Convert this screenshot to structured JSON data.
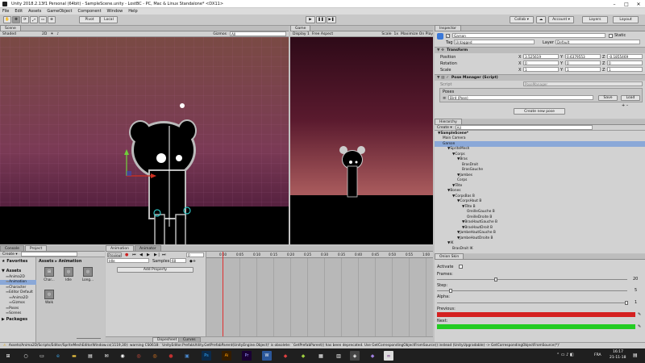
{
  "window": {
    "title": "Unity 2018.2.13f1 Personal (64bit) - SampleScene.unity - LostBC - PC, Mac & Linux Standalone* <DX11>"
  },
  "menu": [
    "File",
    "Edit",
    "Assets",
    "GameObject",
    "Component",
    "Window",
    "Help"
  ],
  "toolbar": {
    "pivot": "Pivot",
    "space": "Local",
    "collab": "Collab ▾",
    "account": "Account ▾",
    "layers": "Layers",
    "layout": "Layout"
  },
  "scene": {
    "tab": "Scene",
    "shading": "Shaded",
    "mode2d": "2D",
    "gizmos": "Gizmos",
    "search": "All"
  },
  "game": {
    "tab": "Game",
    "display": "Display 1",
    "aspect": "Free Aspect",
    "scale_label": "Scale",
    "scale_value": "1x",
    "maximize": "Maximize On Play"
  },
  "inspector": {
    "tab": "Inspector",
    "object_name": "Garson",
    "static": "Static",
    "tag_label": "Tag",
    "tag_value": "Untagged",
    "layer_label": "Layer",
    "layer_value": "Default",
    "transform": {
      "title": "Transform",
      "position": "Position",
      "rotation": "Rotation",
      "scale": "Scale",
      "pos": {
        "x": "3.525619",
        "y": "0.6379553",
        "z": "-0.1855469"
      },
      "rot": {
        "x": "0",
        "y": "0",
        "z": "0"
      },
      "scl": {
        "x": "1",
        "y": "1",
        "z": "1"
      }
    },
    "pose_manager": {
      "title": "Pose Manager (Script)",
      "script_label": "Script",
      "script_value": "PoseManager",
      "poses": "Poses",
      "pose_item": "Bird (Pose)",
      "save": "Save",
      "load": "Load",
      "create": "Create new pose"
    }
  },
  "hierarchy": {
    "tab": "Hierarchy",
    "create": "Create ▾",
    "search": "All",
    "items": [
      {
        "label": "SampleScene*",
        "indent": 0
      },
      {
        "label": "Main Camera",
        "indent": 1
      },
      {
        "label": "Garson",
        "indent": 1
      },
      {
        "label": "SpriteMesh",
        "indent": 2
      },
      {
        "label": "Corps",
        "indent": 3
      },
      {
        "label": "Bras",
        "indent": 4
      },
      {
        "label": "BrasDroit",
        "indent": 5
      },
      {
        "label": "BrasGauche",
        "indent": 5
      },
      {
        "label": "Jambes",
        "indent": 4
      },
      {
        "label": "Corps",
        "indent": 4
      },
      {
        "label": "Tête",
        "indent": 3
      },
      {
        "label": "Bones",
        "indent": 2
      },
      {
        "label": "CorpsBas B",
        "indent": 3
      },
      {
        "label": "CorpsHaut B",
        "indent": 4
      },
      {
        "label": "Tête B",
        "indent": 5
      },
      {
        "label": "OreilleGauche B",
        "indent": 6
      },
      {
        "label": "OreilleDroite B",
        "indent": 6
      },
      {
        "label": "BrasHautGauche B",
        "indent": 5
      },
      {
        "label": "BrasHautDroit B",
        "indent": 5
      },
      {
        "label": "JambeHautGauche B",
        "indent": 4
      },
      {
        "label": "JambeHautDroite B",
        "indent": 4
      },
      {
        "label": "IK",
        "indent": 2
      },
      {
        "label": "BrasDroit IK",
        "indent": 3
      }
    ]
  },
  "onion": {
    "tab": "Onion Skin",
    "activate": "Activate",
    "frames": "Frames:",
    "frames_value": "20",
    "step": "Step:",
    "step_value": "5",
    "alpha": "Alpha:",
    "alpha_value": "1",
    "previous": "Previous:",
    "next": "Next:",
    "prev_color": "#d42020",
    "next_color": "#22cc22"
  },
  "project": {
    "tabs": [
      "Console",
      "Project"
    ],
    "create": "Create ▾",
    "favorites": "Favorites",
    "assets": "Assets",
    "tree": [
      "Anima2D",
      "Animation",
      "Character",
      "Editor Default",
      "Anima2D",
      "Gizmos",
      "Poses",
      "Scenes"
    ],
    "packages": "Packages",
    "breadcrumb": "Assets ▸ Animation",
    "files": [
      {
        "name": "Char...",
        "icon": "anim-controller-icon"
      },
      {
        "name": "Idle",
        "icon": "anim-clip-icon"
      },
      {
        "name": "Long...",
        "icon": "anim-clip-icon"
      },
      {
        "name": "Walk",
        "icon": "anim-clip-icon"
      }
    ]
  },
  "animation": {
    "tabs": [
      "Animation",
      "Animator"
    ],
    "preview": "Preview",
    "clip": "Idle",
    "samples": "Samples",
    "samples_value": "60",
    "frame": "0",
    "add_property": "Add Property",
    "dopesheet": "Dopesheet",
    "curves": "Curves",
    "ticks": [
      "0:00",
      "0:05",
      "0:10",
      "0:15",
      "0:20",
      "0:25",
      "0:30",
      "0:35",
      "0:40",
      "0:45",
      "0:50",
      "0:55",
      "1:00"
    ]
  },
  "status": "Assets/Anima2D/Scripts/Editor/SpriteMeshEditorWindow.cs(1119,30): warning CS0618: `UnityEditor.PrefabUtility.GetPrefabParent(UnityEngine.Object)' is obsolete: `GetPrefabParent() has been deprecated. Use GetCorrespondingObjectFromSource() instead (UnityUpgradable) -> GetCorrespondingObjectFromSource(*)'",
  "taskbar": {
    "time": "16:17",
    "date": "21-11-18",
    "lang": "FRA"
  },
  "colors": {
    "scene_top": "#8a5a4a",
    "scene_grid": "#7a3c78",
    "game_sky_top": "#3a0c1c",
    "game_sky_bottom": "#a85a5c",
    "accent_blue": "#3a78d8"
  }
}
